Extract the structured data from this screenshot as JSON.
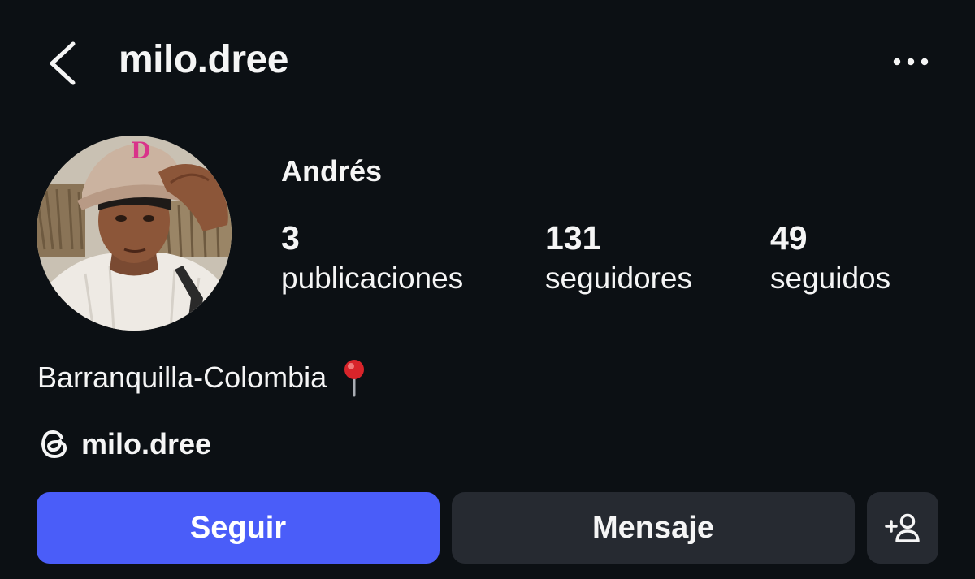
{
  "header": {
    "username": "milo.dree",
    "back_icon": "chevron-left-icon",
    "menu_icon": "more-horizontal-icon"
  },
  "profile": {
    "display_name": "Andrés",
    "stats": [
      {
        "value": "3",
        "label": "publicaciones"
      },
      {
        "value": "131",
        "label": "seguidores"
      },
      {
        "value": "49",
        "label": "seguidos"
      }
    ],
    "bio": "Barranquilla-Colombia",
    "bio_icon": "round-pushpin-icon",
    "threads_handle": "milo.dree",
    "threads_icon": "threads-icon"
  },
  "actions": {
    "follow_label": "Seguir",
    "message_label": "Mensaje",
    "add_person_icon": "add-person-icon"
  },
  "colors": {
    "background": "#0c1014",
    "text": "#f5f5f5",
    "primary_button": "#4a5df9",
    "secondary_button": "#262a31"
  }
}
